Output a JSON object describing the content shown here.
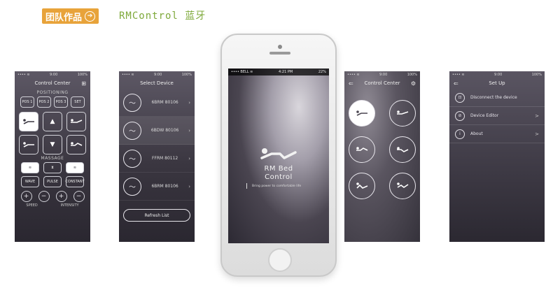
{
  "header": {
    "badge_label": "团队作品",
    "badge_arrow": "➔",
    "title": "RMControl 蓝牙"
  },
  "control_screen": {
    "status_left": "•••• ≋",
    "status_center": "9:00",
    "status_right": "100%",
    "title": "Control Center",
    "positioning_label": "POSITIONING",
    "pos_buttons": [
      "POS 1",
      "POS 2",
      "POS 3",
      "SET"
    ],
    "massage_label": "MASSAGE",
    "mode_buttons": [
      "WAVE",
      "PULSE",
      "CONSTANT"
    ],
    "speed_label": "SPEED",
    "intensity_label": "INTENSITY",
    "plus": "+",
    "minus": "−"
  },
  "select_screen": {
    "status_left": "•••• ≋",
    "status_center": "9:00",
    "status_right": "100%",
    "title": "Select Device",
    "devices": [
      "6BRM 80106",
      "6BDW 80106",
      "FFRM 80112",
      "6BRM 80106"
    ],
    "refresh_label": "Refresh List"
  },
  "center_phone": {
    "status_left": "•••• BELL ≋",
    "status_center": "4:21 PM",
    "status_right": "22%",
    "title_line1": "RM Bed",
    "title_line2": "Control",
    "tagline": "Bring power to comfortable life"
  },
  "icon_screen": {
    "status_left": "•••• ≋",
    "status_center": "9:00",
    "status_right": "100%",
    "title": "Control Center"
  },
  "setup_screen": {
    "status_left": "•••• ≋",
    "status_center": "9:00",
    "status_right": "100%",
    "title": "Set Up",
    "items": [
      {
        "label": "Disconnect the device",
        "icon": "lock-icon",
        "chevron": ""
      },
      {
        "label": "Device Editor",
        "icon": "edit-icon",
        "chevron": ">"
      },
      {
        "label": "About",
        "icon": "info-icon",
        "chevron": ">"
      }
    ]
  },
  "colors": {
    "badge": "#e8a33a",
    "title_green": "#7ea93a",
    "screen_dark": "#3a3640"
  }
}
